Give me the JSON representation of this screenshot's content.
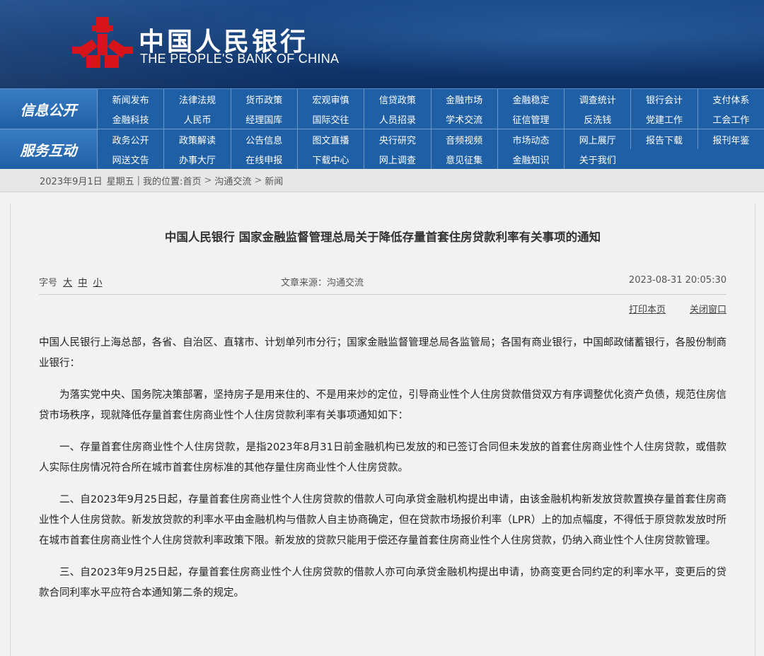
{
  "header": {
    "cn_name": "中国人民银行",
    "en_name": "THE PEOPLE'S BANK OF CHINA",
    "logo_icon": "pboc-logo-icon",
    "logo_color": "#d8141b"
  },
  "nav": {
    "row1_label": "信息公开",
    "row2_label": "服务互动",
    "row1_items": [
      "新闻发布",
      "法律法规",
      "货币政策",
      "宏观审慎",
      "信贷政策",
      "金融市场",
      "金融稳定",
      "调查统计",
      "银行会计",
      "支付体系",
      "金融科技",
      "人民币",
      "经理国库",
      "国际交往",
      "人员招录",
      "学术交流",
      "征信管理",
      "反洗钱",
      "党建工作",
      "工会工作"
    ],
    "row2_items": [
      "政务公开",
      "政策解读",
      "公告信息",
      "图文直播",
      "央行研究",
      "音频视频",
      "市场动态",
      "网上展厅",
      "报告下载",
      "报刊年鉴",
      "网送文告",
      "办事大厅",
      "在线申报",
      "下载中心",
      "网上调查",
      "意见征集",
      "金融知识",
      "关于我们"
    ]
  },
  "breadcrumb": {
    "date": "2023年9月1日",
    "weekday": "星期五",
    "location_prefix": "我的位置:",
    "home": "首页",
    "section": "沟通交流",
    "current": "新闻"
  },
  "article": {
    "title": "中国人民银行 国家金融监督管理总局关于降低存量首套住房贷款利率有关事项的通知",
    "font_size_label": "字号",
    "font_large": "大",
    "font_medium": "中",
    "font_small": "小",
    "source": "文章来源：沟通交流",
    "datetime": "2023-08-31 20:05:30",
    "print_label": "打印本页",
    "close_label": "关闭窗口",
    "paragraphs": [
      "中国人民银行上海总部，各省、自治区、直辖市、计划单列市分行；国家金融监督管理总局各监管局；各国有商业银行，中国邮政储蓄银行，各股份制商业银行：",
      "为落实党中央、国务院决策部署，坚持房子是用来住的、不是用来炒的定位，引导商业性个人住房贷款借贷双方有序调整优化资产负债，规范住房信贷市场秩序，现就降低存量首套住房商业性个人住房贷款利率有关事项通知如下：",
      "一、存量首套住房商业性个人住房贷款，是指2023年8月31日前金融机构已发放的和已签订合同但未发放的首套住房商业性个人住房贷款，或借款人实际住房情况符合所在城市首套住房标准的其他存量住房商业性个人住房贷款。",
      "二、自2023年9月25日起，存量首套住房商业性个人住房贷款的借款人可向承贷金融机构提出申请，由该金融机构新发放贷款置换存量首套住房商业性个人住房贷款。新发放贷款的利率水平由金融机构与借款人自主协商确定，但在贷款市场报价利率（LPR）上的加点幅度，不得低于原贷款发放时所在城市首套住房商业性个人住房贷款利率政策下限。新发放的贷款只能用于偿还存量首套住房商业性个人住房贷款，仍纳入商业性个人住房贷款管理。",
      "三、自2023年9月25日起，存量首套住房商业性个人住房贷款的借款人亦可向承贷金融机构提出申请，协商变更合同约定的利率水平，变更后的贷款合同利率水平应符合本通知第二条的规定。"
    ]
  }
}
